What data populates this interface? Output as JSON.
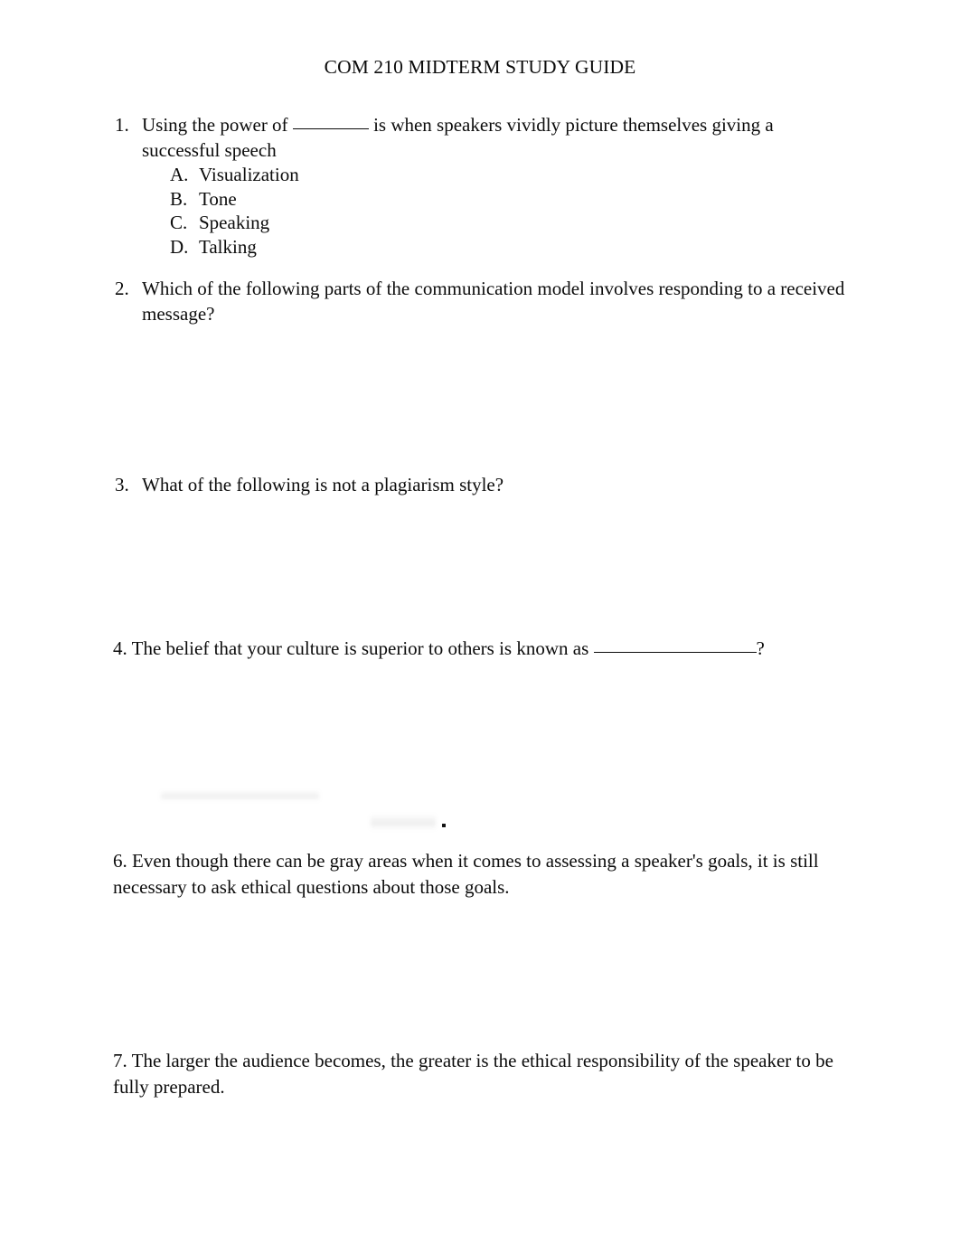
{
  "document": {
    "title": "COM 210 MIDTERM STUDY GUIDE",
    "page_background": "#ffffff",
    "text_color": "#0c0c0c"
  },
  "questions": [
    {
      "number": "1.",
      "text_before_blank": "Using the power of ",
      "text_after_blank": " is when speakers vividly picture themselves giving a successful speech",
      "has_blank": true,
      "blank_style": "short",
      "options": [
        {
          "letter": "A.",
          "label": "Visualization"
        },
        {
          "letter": "B.",
          "label": "Tone"
        },
        {
          "letter": "C.",
          "label": "Speaking"
        },
        {
          "letter": "D.",
          "label": "Talking"
        }
      ]
    },
    {
      "number": "2.",
      "text": "Which of the following parts of the communication model involves responding to a received message?",
      "options": []
    },
    {
      "number": "3.",
      "text": "What of the following is not a plagiarism style?",
      "options": []
    }
  ],
  "paragraph_questions": [
    {
      "id": "q4",
      "text_before_blank": "4. The belief that your culture is superior to others is known as ",
      "text_after_blank": "?",
      "has_blank": true,
      "blank_style": "long"
    },
    {
      "id": "q6",
      "text": "6. Even though there can be gray areas when it comes to assessing a speaker's goals, it is still necessary to ask ethical questions about those goals."
    },
    {
      "id": "q7",
      "text": "7. The larger the audience becomes, the greater is the ethical responsibility of the speaker to be fully prepared."
    }
  ],
  "erased_content": {
    "description": "whited-out question 5 residue",
    "visible_period": "."
  }
}
